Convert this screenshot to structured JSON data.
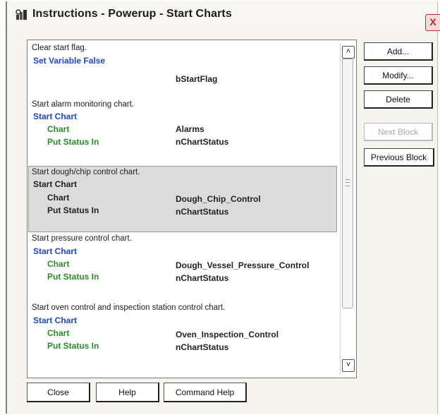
{
  "window": {
    "title": "Instructions - Powerup - Start Charts",
    "close_glyph": "X",
    "icon": "chart-icon"
  },
  "blocks": [
    {
      "comment": "Clear start flag.",
      "command": "Set Variable False",
      "args": [
        {
          "name": "",
          "value": "bStartFlag"
        }
      ]
    },
    {
      "comment": "Start alarm monitoring chart.",
      "command": "Start Chart",
      "args": [
        {
          "name": "Chart",
          "value": "Alarms"
        },
        {
          "name": "Put Status In",
          "value": "nChartStatus"
        }
      ]
    },
    {
      "comment": "Start dough/chip control chart.",
      "command": "Start Chart",
      "selected": true,
      "args": [
        {
          "name": "Chart",
          "value": "Dough_Chip_Control"
        },
        {
          "name": "Put Status In",
          "value": "nChartStatus"
        }
      ]
    },
    {
      "comment": "Start pressure control chart.",
      "command": "Start Chart",
      "args": [
        {
          "name": "Chart",
          "value": "Dough_Vessel_Pressure_Control"
        },
        {
          "name": "Put Status In",
          "value": "nChartStatus"
        }
      ]
    },
    {
      "comment": "Start oven control and inspection station control chart.",
      "command": "Start Chart",
      "args": [
        {
          "name": "Chart",
          "value": "Oven_Inspection_Control"
        },
        {
          "name": "Put Status In",
          "value": "nChartStatus"
        }
      ]
    }
  ],
  "side_buttons": {
    "add": "Add...",
    "modify": "Modify...",
    "delete": "Delete",
    "next_block": "Next Block",
    "previous_block": "Previous Block"
  },
  "bottom_buttons": {
    "close": "Close",
    "help": "Help",
    "command_help": "Command Help"
  },
  "scrollbar": {
    "up_glyph": "˄",
    "down_glyph": "˅"
  },
  "colors": {
    "command": "#2147c8",
    "argument_name": "#2c8a2c",
    "selected_block": "#dcdcdc"
  }
}
